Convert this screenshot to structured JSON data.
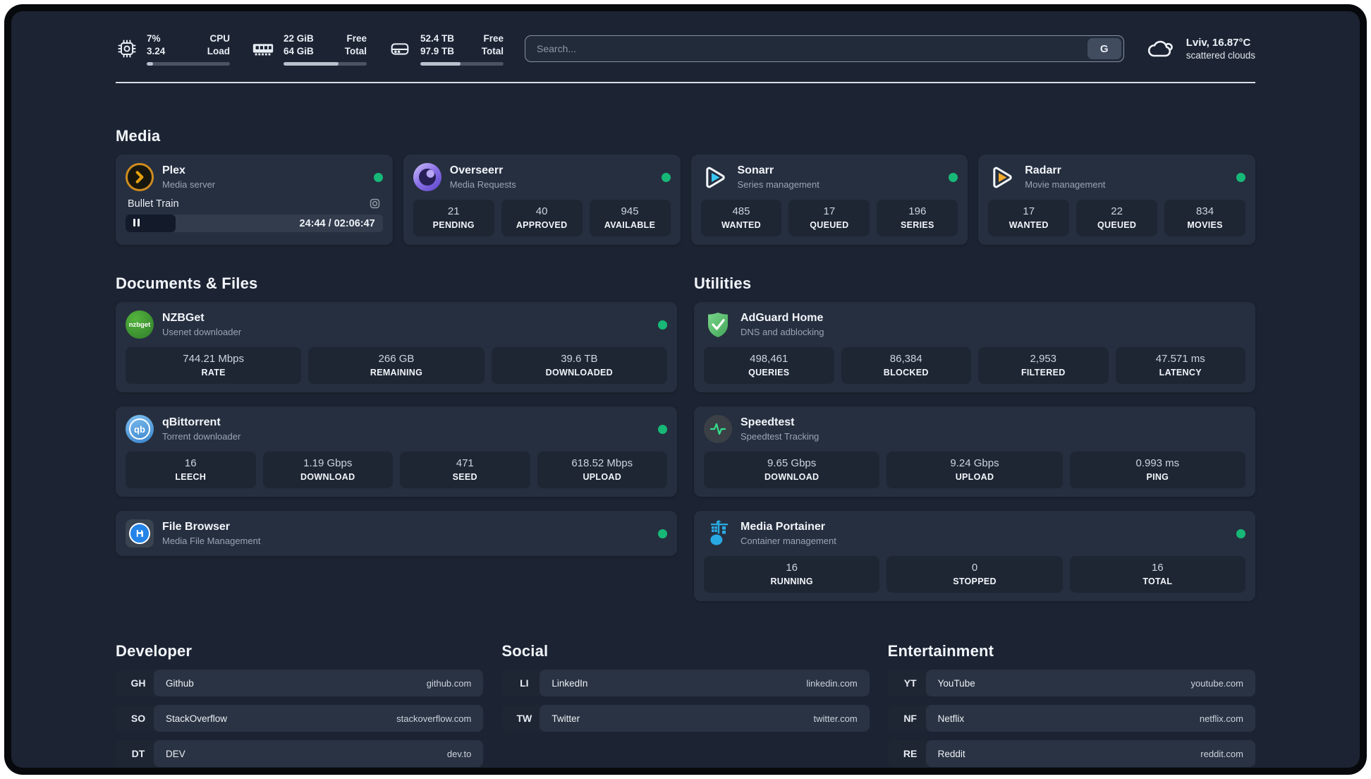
{
  "colors": {
    "accent_green": "#17b877",
    "background": "#1c2433",
    "card": "#262f3f"
  },
  "header": {
    "metrics": [
      {
        "name": "cpu",
        "value1": "7%",
        "label1": "CPU",
        "value2": "3.24",
        "label2": "Load",
        "progress": 8
      },
      {
        "name": "memory",
        "value1": "22 GiB",
        "label1": "Free",
        "value2": "64 GiB",
        "label2": "Total",
        "progress": 66
      },
      {
        "name": "storage",
        "value1": "52.4 TB",
        "label1": "Free",
        "value2": "97.9 TB",
        "label2": "Total",
        "progress": 48
      }
    ],
    "search": {
      "placeholder": "Search...",
      "provider": "G"
    },
    "weather": {
      "location": "Lviv, 16.87°C",
      "condition": "scattered clouds"
    }
  },
  "media": {
    "title": "Media",
    "plex": {
      "name": "Plex",
      "desc": "Media server",
      "session": {
        "title": "Bullet Train",
        "time": "24:44 / 02:06:47",
        "progress": 19.5
      }
    },
    "overseerr": {
      "name": "Overseerr",
      "desc": "Media Requests",
      "stats": [
        {
          "value": "21",
          "label": "PENDING"
        },
        {
          "value": "40",
          "label": "APPROVED"
        },
        {
          "value": "945",
          "label": "AVAILABLE"
        }
      ]
    },
    "sonarr": {
      "name": "Sonarr",
      "desc": "Series management",
      "stats": [
        {
          "value": "485",
          "label": "WANTED"
        },
        {
          "value": "17",
          "label": "QUEUED"
        },
        {
          "value": "196",
          "label": "SERIES"
        }
      ]
    },
    "radarr": {
      "name": "Radarr",
      "desc": "Movie management",
      "stats": [
        {
          "value": "17",
          "label": "WANTED"
        },
        {
          "value": "22",
          "label": "QUEUED"
        },
        {
          "value": "834",
          "label": "MOVIES"
        }
      ]
    }
  },
  "documents": {
    "title": "Documents & Files",
    "nzbget": {
      "name": "NZBGet",
      "desc": "Usenet downloader",
      "icon_text": "nzbget",
      "stats": [
        {
          "value": "744.21 Mbps",
          "label": "RATE"
        },
        {
          "value": "266 GB",
          "label": "REMAINING"
        },
        {
          "value": "39.6 TB",
          "label": "DOWNLOADED"
        }
      ]
    },
    "qbittorrent": {
      "name": "qBittorrent",
      "desc": "Torrent downloader",
      "icon_text": "qb",
      "stats": [
        {
          "value": "16",
          "label": "LEECH"
        },
        {
          "value": "1.19 Gbps",
          "label": "DOWNLOAD"
        },
        {
          "value": "471",
          "label": "SEED"
        },
        {
          "value": "618.52 Mbps",
          "label": "UPLOAD"
        }
      ]
    },
    "filebrowser": {
      "name": "File Browser",
      "desc": "Media File Management"
    }
  },
  "utilities": {
    "title": "Utilities",
    "adguard": {
      "name": "AdGuard Home",
      "desc": "DNS and adblocking",
      "stats": [
        {
          "value": "498,461",
          "label": "QUERIES"
        },
        {
          "value": "86,384",
          "label": "BLOCKED"
        },
        {
          "value": "2,953",
          "label": "FILTERED"
        },
        {
          "value": "47.571 ms",
          "label": "LATENCY"
        }
      ]
    },
    "speedtest": {
      "name": "Speedtest",
      "desc": "Speedtest Tracking",
      "stats": [
        {
          "value": "9.65 Gbps",
          "label": "DOWNLOAD"
        },
        {
          "value": "9.24 Gbps",
          "label": "UPLOAD"
        },
        {
          "value": "0.993 ms",
          "label": "PING"
        }
      ]
    },
    "portainer": {
      "name": "Media Portainer",
      "desc": "Container management",
      "stats": [
        {
          "value": "16",
          "label": "RUNNING"
        },
        {
          "value": "0",
          "label": "STOPPED"
        },
        {
          "value": "16",
          "label": "TOTAL"
        }
      ]
    }
  },
  "bookmarks": [
    {
      "title": "Developer",
      "items": [
        {
          "abbr": "GH",
          "name": "Github",
          "url": "github.com"
        },
        {
          "abbr": "SO",
          "name": "StackOverflow",
          "url": "stackoverflow.com"
        },
        {
          "abbr": "DT",
          "name": "DEV",
          "url": "dev.to"
        }
      ]
    },
    {
      "title": "Social",
      "items": [
        {
          "abbr": "LI",
          "name": "LinkedIn",
          "url": "linkedin.com"
        },
        {
          "abbr": "TW",
          "name": "Twitter",
          "url": "twitter.com"
        }
      ]
    },
    {
      "title": "Entertainment",
      "items": [
        {
          "abbr": "YT",
          "name": "YouTube",
          "url": "youtube.com"
        },
        {
          "abbr": "NF",
          "name": "Netflix",
          "url": "netflix.com"
        },
        {
          "abbr": "RE",
          "name": "Reddit",
          "url": "reddit.com"
        }
      ]
    }
  ]
}
